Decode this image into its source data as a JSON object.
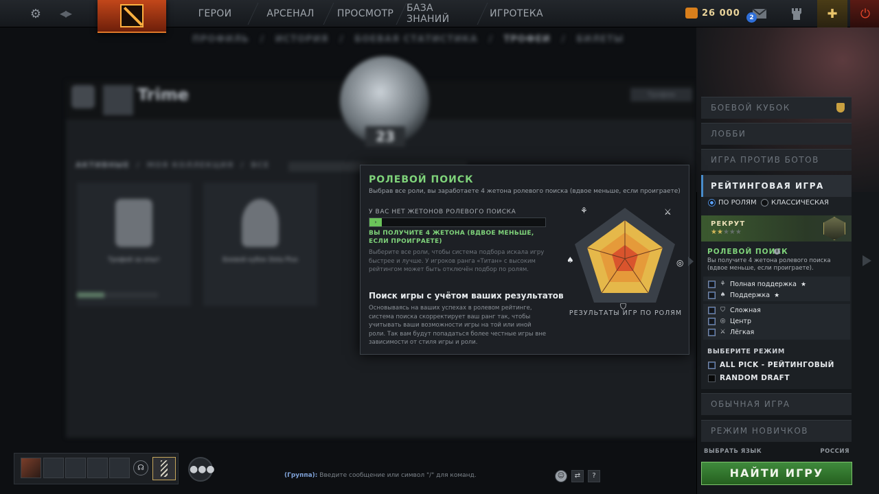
{
  "topbar": {
    "nav": [
      "ГЕРОИ",
      "АРСЕНАЛ",
      "ПРОСМОТР",
      "БАЗА ЗНАНИЙ",
      "ИГРОТЕКА"
    ],
    "gold": "26 000",
    "mail_count": "2"
  },
  "profile": {
    "tabs": [
      "ПРОФИЛЬ",
      "/",
      "ИСТОРИЯ",
      "/",
      "БОЕВАЯ СТАТИСТИКА",
      "/",
      "ТРОФЕИ",
      "/",
      "БИЛЕТЫ"
    ],
    "player_name": "Trime",
    "trophy_button": "Трофеи",
    "rank_level": "23",
    "subtabs": [
      "АКТИВНЫЕ",
      "/",
      "МОЯ КОЛЛЕКЦИЯ",
      "/",
      "ВСЕ"
    ],
    "trophy_cards": [
      "Трофей за опыт",
      "Боевой кубок Dota Plus"
    ]
  },
  "tooltip": {
    "title": "РОЛЕВОЙ ПОИСК",
    "subtitle": "Выбрав все роли, вы заработаете 4 жетона ролевого поиска (вдвое меньше, если проиграете)",
    "no_tokens": "У ВАС НЕТ ЖЕТОНОВ РОЛЕВОГО ПОИСКА",
    "token_progress": 0.07,
    "will_receive": "ВЫ ПОЛУЧИТЕ 4 ЖЕТОНА (ВДВОЕ МЕНЬШЕ, ЕСЛИ ПРОИГРАЕТЕ)",
    "hint": "Выберите все роли, чтобы система подбора искала игру быстрее и лучше. У игроков ранга «Титан» с высоким рейтингом может быть отключён подбор по ролям.",
    "section_title": "Поиск игры с учётом ваших результатов",
    "section_text": "Основываясь на ваших успехах в ролевом рейтинге, система поиска скорректирует ваш ранг так, чтобы учитывать ваши возможности игры на той или иной роли. Так вам будут попадаться более честные игры вне зависимости от стиля игры и роли.",
    "radar_label": "РЕЗУЛЬТАТЫ ИГР ПО РОЛЯМ"
  },
  "right_panel": {
    "battle_cup": "БОЕВОЙ КУБОК",
    "lobby": "ЛОББИ",
    "bots": "ИГРА ПРОТИВ БОТОВ",
    "ranked": "РЕЙТИНГОВАЯ ИГРА",
    "radio_roles": "ПО РОЛЯМ",
    "radio_classic": "КЛАССИЧЕСКАЯ",
    "rank_name": "РЕКРУТ",
    "rank_stars_lit": 2,
    "rank_stars_total": 5,
    "role_queue_title": "РОЛЕВОЙ ПОИСК",
    "role_queue_desc": "Вы получите 4 жетона ролевого поиска (вдвое меньше, если проиграете).",
    "roles": [
      {
        "label": "Полная поддержка",
        "star": "★",
        "icon": "hard-support-icon"
      },
      {
        "label": "Поддержка",
        "star": "★",
        "icon": "support-icon"
      },
      {
        "label": "Сложная",
        "star": "",
        "icon": "offlane-icon"
      },
      {
        "label": "Центр",
        "star": "",
        "icon": "mid-icon"
      },
      {
        "label": "Лёгкая",
        "star": "",
        "icon": "carry-icon"
      }
    ],
    "mode_title": "ВЫБЕРИТЕ РЕЖИМ",
    "modes": [
      "ALL PICK - РЕЙТИНГОВЫЙ",
      "RANDOM DRAFT"
    ],
    "normal": "ОБЫЧНАЯ ИГРА",
    "newbie": "РЕЖИМ НОВИЧКОВ",
    "lang_label": "ВЫБРАТЬ ЯЗЫК",
    "lang_value": "РОССИЯ",
    "find_button": "НАЙТИ ИГРУ"
  },
  "bottom": {
    "chat_channel": "(Группа):",
    "chat_placeholder": "Введите сообщение или символ \"/\" для команд.",
    "help": "?"
  },
  "colors": {
    "accent_green": "#7fd37a",
    "find_green": "#3f8a3c",
    "logo_orange": "#c2471a",
    "radar_outer": "#e5b84a",
    "radar_mid": "#e59a3a",
    "radar_inner": "#d9542d"
  }
}
